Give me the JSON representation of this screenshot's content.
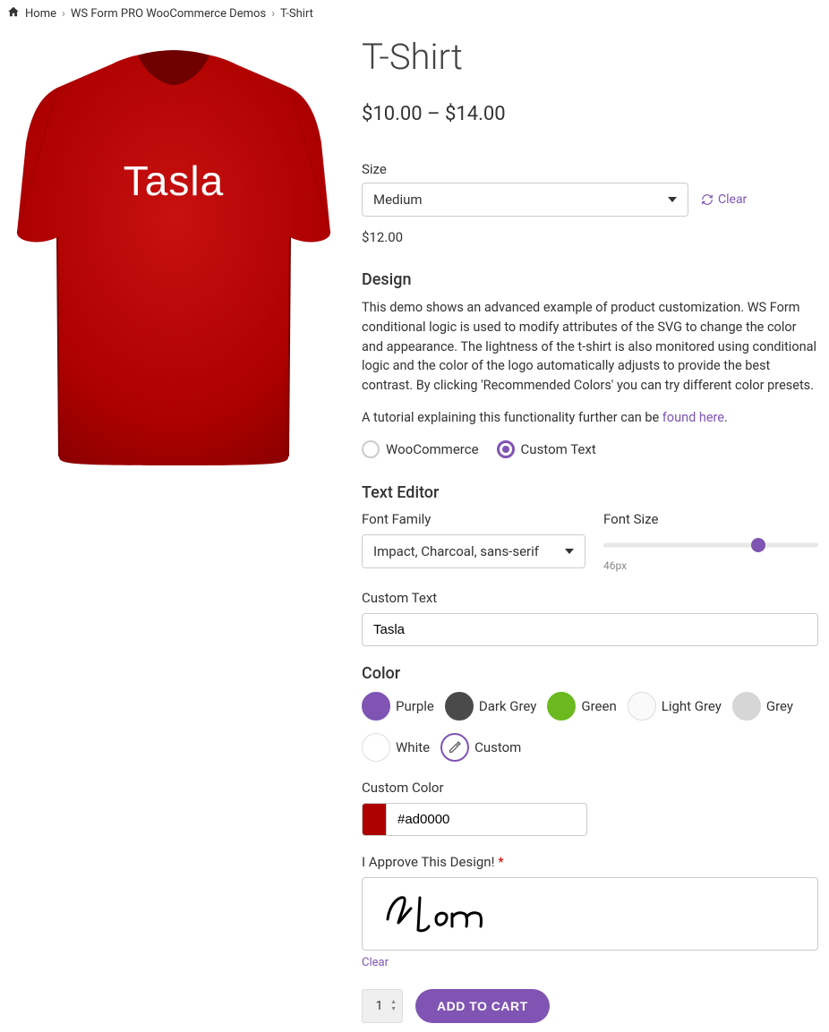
{
  "breadcrumb": {
    "home": "Home",
    "cat": "WS Form PRO WooCommerce Demos",
    "current": "T-Shirt"
  },
  "product": {
    "title": "T-Shirt",
    "price_low": "$10.00",
    "price_sep": "–",
    "price_high": "$14.00",
    "variant_price": "$12.00"
  },
  "size": {
    "label": "Size",
    "value": "Medium",
    "clear": "Clear"
  },
  "design": {
    "heading": "Design",
    "para": "This demo shows an advanced example of product customization. WS Form conditional logic is used to modify attributes of the SVG to change the color and appearance. The lightness of the t-shirt is also monitored using conditional logic and the color of the logo automatically adjusts to provide the best contrast. By clicking 'Recommended Colors' you can try different color presets.",
    "tutorial_prefix": "A tutorial explaining this functionality further can be ",
    "tutorial_link": "found here",
    "tutorial_suffix": "."
  },
  "logo_mode": {
    "woo": "WooCommerce",
    "custom": "Custom Text"
  },
  "editor": {
    "heading": "Text Editor",
    "font_family_label": "Font Family",
    "font_family_value": "Impact, Charcoal, sans-serif",
    "font_size_label": "Font Size",
    "font_size_value": "46px",
    "custom_text_label": "Custom Text",
    "custom_text_value": "Tasla"
  },
  "color": {
    "heading": "Color",
    "options": {
      "purple": "Purple",
      "darkgrey": "Dark Grey",
      "green": "Green",
      "lightgrey": "Light Grey",
      "grey": "Grey",
      "white": "White",
      "custom": "Custom"
    },
    "custom_label": "Custom Color",
    "custom_value": "#ad0000"
  },
  "approve": {
    "label": "I Approve This Design!",
    "clear": "Clear"
  },
  "cart": {
    "qty": "1",
    "add": "ADD TO CART"
  }
}
